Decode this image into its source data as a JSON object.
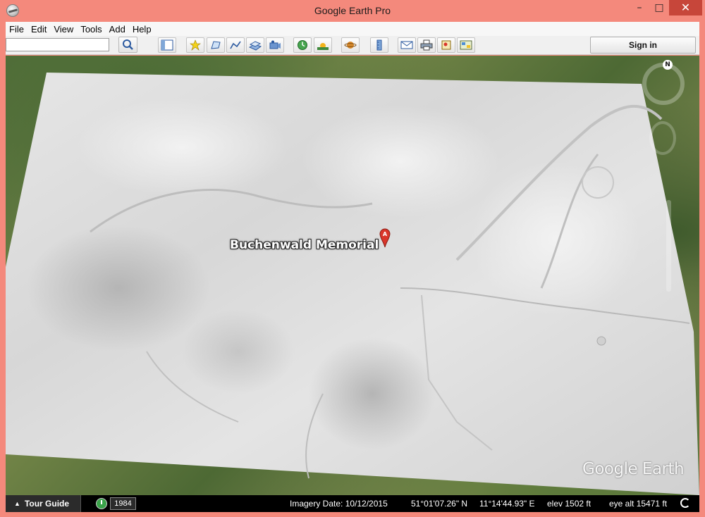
{
  "window": {
    "title": "Google Earth Pro",
    "minimize": "–",
    "maximize": "□",
    "close": "✕"
  },
  "menu": [
    "File",
    "Edit",
    "View",
    "Tools",
    "Add",
    "Help"
  ],
  "search": {
    "value": "",
    "placeholder": ""
  },
  "toolbar": {
    "icons": [
      "sidebar-icon",
      "placemark-icon",
      "polygon-icon",
      "path-icon",
      "image-overlay-icon",
      "record-tour-icon",
      "historical-imagery-icon",
      "sunlight-icon",
      "planets-icon",
      "ruler-icon",
      "email-icon",
      "print-icon",
      "save-image-icon",
      "view-in-maps-icon"
    ],
    "sign_in": "Sign in"
  },
  "map": {
    "placemark": {
      "label": "Buchenwald Memorial",
      "marker": "A"
    },
    "watermark": "Google Earth",
    "compass": "N"
  },
  "status": {
    "tour_guide": "Tour Guide",
    "year": "1984",
    "imagery_date": "Imagery Date: 10/12/2015",
    "latitude": "51°01'07.26\" N",
    "longitude": "11°14'44.93\" E",
    "elev": "elev  1502 ft",
    "eye_alt": "eye alt  15471 ft"
  },
  "colors": {
    "frame": "#f4897c",
    "close_button": "#c7463a",
    "pin": "#d9352a"
  }
}
